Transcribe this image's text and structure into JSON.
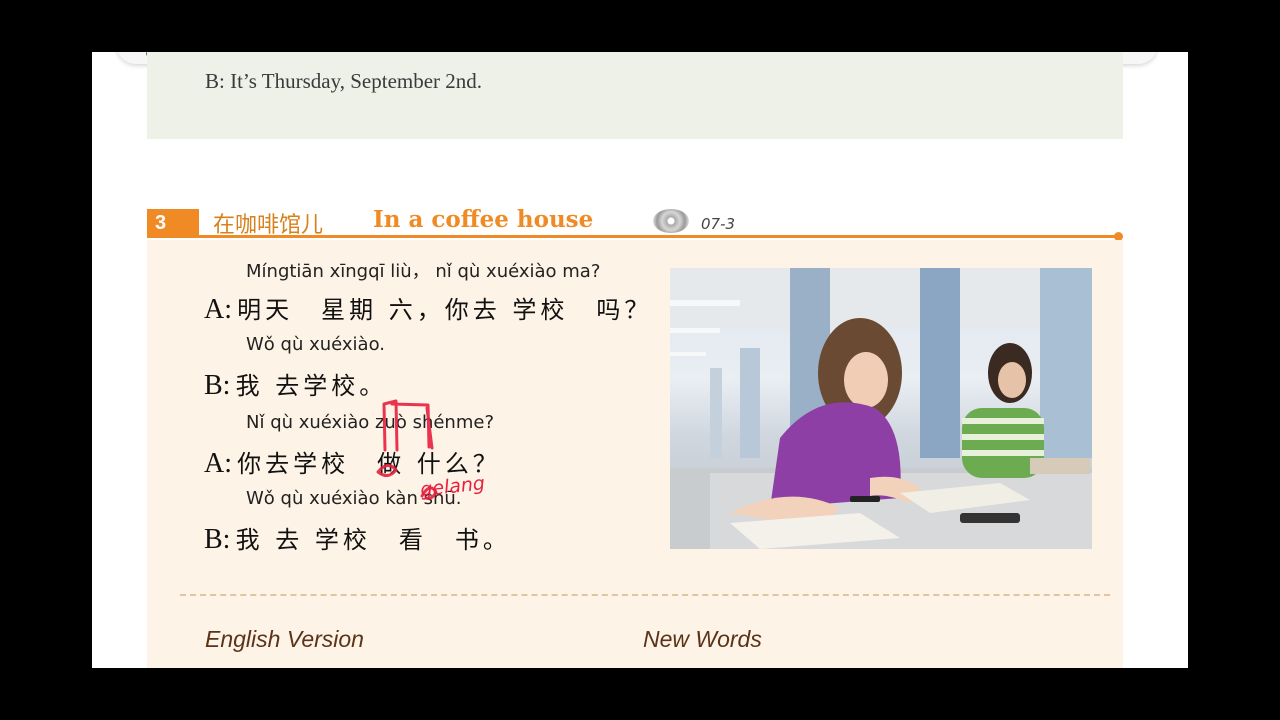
{
  "previous_box": {
    "line": "B: It’s Thursday, September 2nd."
  },
  "section": {
    "number": "3",
    "title_cn": "在咖啡馆儿",
    "title_en": "In a coffee house",
    "audio_icon": "cd-icon",
    "track": "07-3"
  },
  "dialogue": [
    {
      "pinyin": "Míngtiān xīngqī liù， nǐ qù xuéxiào ma?",
      "speaker": "A:",
      "hanzi": "明天　星期 六，你去 学校　吗？"
    },
    {
      "pinyin": "Wǒ qù xuéxiào.",
      "speaker": "B:",
      "hanzi": "我 去学校。"
    },
    {
      "pinyin": "Nǐ qù xuéxiào zuò shénme?",
      "speaker": "A:",
      "hanzi": "你去学校　做 什么？"
    },
    {
      "pinyin": "Wǒ qù xuéxiào kàn shū.",
      "speaker": "B:",
      "hanzi": "我 去 学校　看　书。"
    }
  ],
  "annotation": {
    "handwritten_text": "gelang",
    "color": "#e8203f"
  },
  "footer": {
    "english_version": "English Version",
    "new_words": "New Words"
  },
  "colors": {
    "accent": "#f08a24",
    "dialog_bg": "#fdf3e7",
    "prev_box_bg": "#eef1e8"
  }
}
